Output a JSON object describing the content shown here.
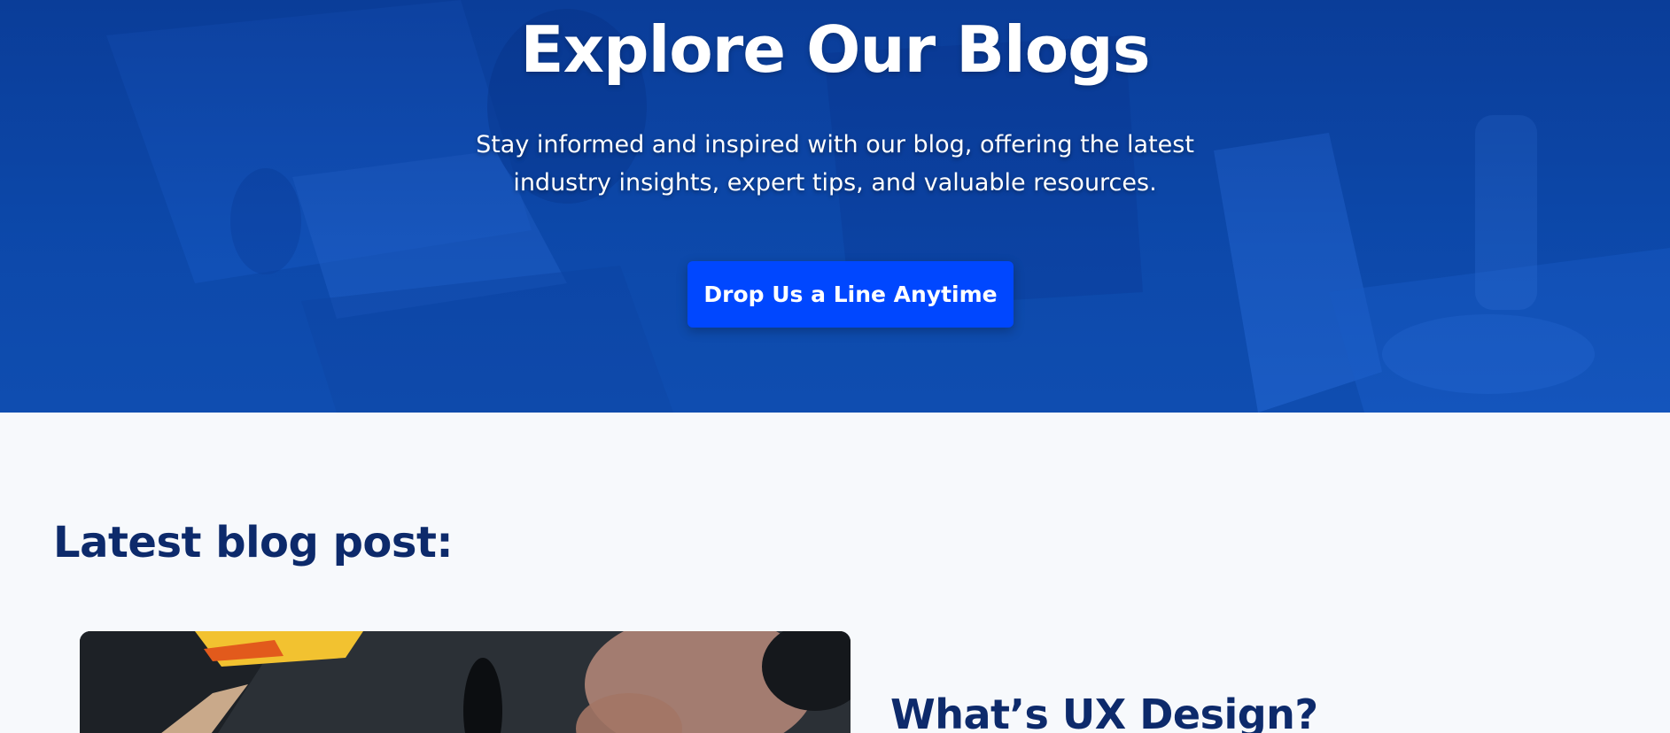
{
  "hero": {
    "title": "Explore Our Blogs",
    "subtitle_line1": "Stay informed and inspired with our blog, offering the latest",
    "subtitle_line2": "industry insights, expert tips, and valuable resources.",
    "cta_label": "Drop Us a Line Anytime",
    "background_image": "team-working-on-laptops-photo"
  },
  "latest": {
    "heading": "Latest blog post:",
    "post": {
      "title": "What’s UX Design?",
      "image": "hands-working-on-desk-photo"
    }
  },
  "colors": {
    "hero_blue": "#0f4fb0",
    "cta_blue": "#0047ff",
    "heading_navy": "#0d2a6b",
    "page_background": "#f7f9fc"
  }
}
